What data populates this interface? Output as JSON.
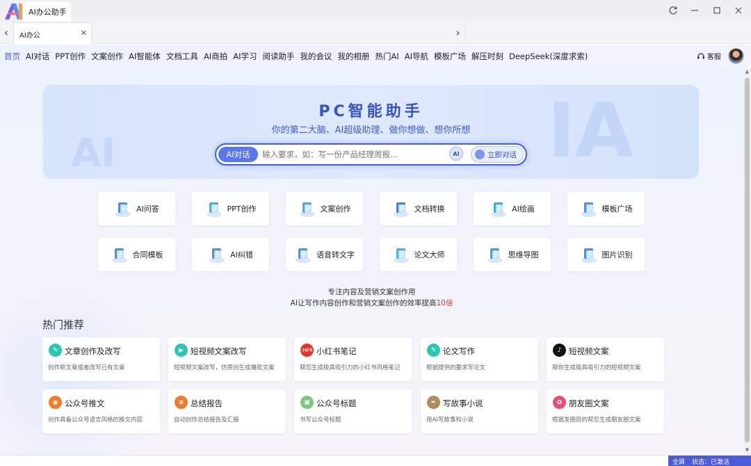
{
  "window": {
    "app_title": "AI办公助手",
    "controls": [
      "refresh-icon",
      "minimize-icon",
      "maximize-icon",
      "close-icon"
    ]
  },
  "tabbar": {
    "tab_label": "AI办公"
  },
  "topnav": {
    "items": [
      "首页",
      "AI对话",
      "PPT创作",
      "文案创作",
      "AI智能体",
      "文档工具",
      "AI商拍",
      "AI学习",
      "阅读助手",
      "我的会议",
      "我的相册",
      "热门AI",
      "AI导航",
      "模板广场",
      "解压时刻",
      "DeepSeek(深度求索)"
    ],
    "active_index": 0,
    "kefu_label": "客服"
  },
  "hero": {
    "title": "PC智能助手",
    "subtitle": "你的第二大脑、AI超级助理、做你想做、想你所想",
    "search_tag": "AI对话",
    "search_placeholder": "输入要求，如：写一份产品经理周报...",
    "ai_badge": "AI",
    "chat_button": "立即对话",
    "ghost_left": "AI",
    "ghost_right": "IA"
  },
  "tools": [
    {
      "label": "AI问答",
      "icon": "qa-icon",
      "color": "#3f7de8"
    },
    {
      "label": "PPT创作",
      "icon": "ppt-icon",
      "color": "#2fa6d8"
    },
    {
      "label": "文案创作",
      "icon": "writing-icon",
      "color": "#3aa0d8"
    },
    {
      "label": "文档转换",
      "icon": "document-convert-icon",
      "color": "#3a6ee6"
    },
    {
      "label": "AI绘画",
      "icon": "painting-icon",
      "color": "#2aa2d6"
    },
    {
      "label": "模板广场",
      "icon": "template-icon",
      "color": "#3d86e8"
    },
    {
      "label": "合同模板",
      "icon": "contract-icon",
      "color": "#3a80e6"
    },
    {
      "label": "AI纠错",
      "icon": "proofread-icon",
      "color": "#3b7fe4"
    },
    {
      "label": "语音转文字",
      "icon": "microphone-icon",
      "color": "#2f8fe0"
    },
    {
      "label": "论文大师",
      "icon": "paper-icon",
      "color": "#39a4d6"
    },
    {
      "label": "思维导图",
      "icon": "mindmap-icon",
      "color": "#2f90e2"
    },
    {
      "label": "图片识别",
      "icon": "image-recognition-icon",
      "color": "#3c7fe6"
    }
  ],
  "tagline": {
    "line1": "专注内容及营销文案创作用",
    "line2_prefix": "AI让写作内容创作和营销文案创作的效率提高",
    "line2_highlight": "10倍"
  },
  "recommend": {
    "title": "热门推荐",
    "items": [
      {
        "title": "文章创作及改写",
        "desc": "创作新文章或者改写已有文章",
        "icon": "article-icon",
        "color": "#2ec4b6",
        "glyph": "✎"
      },
      {
        "title": "短视频文案改写",
        "desc": "短视频文案改写，仿原创生成爆款文案",
        "icon": "video-script-icon",
        "color": "#2ec4b6",
        "glyph": "▶"
      },
      {
        "title": "小红书笔记",
        "desc": "帮您生成极具吸引力的小红书风格笔记",
        "icon": "xiaohongshu-icon",
        "color": "#e8332b",
        "glyph": "小红书"
      },
      {
        "title": "论文写作",
        "desc": "根据提供的要求写论文",
        "icon": "paper-writing-icon",
        "color": "#2ec4b6",
        "glyph": "✎"
      },
      {
        "title": "短视频文案",
        "desc": "帮你生成极具吸引力的短视频文案",
        "icon": "douyin-icon",
        "color": "#111111",
        "glyph": "♪"
      },
      {
        "title": "公众号推文",
        "desc": "创作具备公众号语言风格的推文内容",
        "icon": "wechat-article-icon",
        "color": "#f07a2a",
        "glyph": "◉"
      },
      {
        "title": "总结报告",
        "desc": "自动创作总结报告及汇报",
        "icon": "report-icon",
        "color": "#f07a2a",
        "glyph": "≡"
      },
      {
        "title": "公众号标题",
        "desc": "书写公众号标题",
        "icon": "wechat-title-icon",
        "color": "#7bc67e",
        "glyph": "▣"
      },
      {
        "title": "写故事小说",
        "desc": "用AI写故事和小说",
        "icon": "story-icon",
        "color": "#b38a5a",
        "glyph": "✒"
      },
      {
        "title": "朋友圈文案",
        "desc": "根据发圈目的帮您生成朋友圈文案",
        "icon": "moments-icon",
        "color": "#e94e77",
        "glyph": "✿"
      }
    ]
  },
  "statusbar": {
    "fullscreen": "全屏",
    "status": "状态：已激活"
  }
}
